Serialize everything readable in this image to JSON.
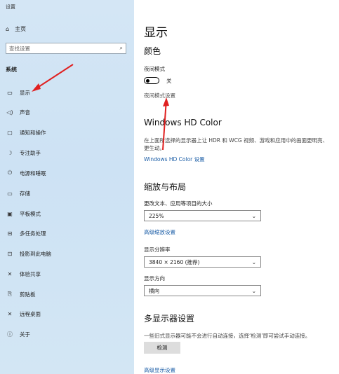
{
  "window": {
    "title": "设置"
  },
  "sidebar": {
    "home": "主页",
    "search_placeholder": "查找设置",
    "section": "系统",
    "items": [
      {
        "label": "显示",
        "icon": "monitor-icon"
      },
      {
        "label": "声音",
        "icon": "speaker-icon"
      },
      {
        "label": "通知和操作",
        "icon": "notification-icon"
      },
      {
        "label": "专注助手",
        "icon": "moon-icon"
      },
      {
        "label": "电源和睡眠",
        "icon": "power-icon"
      },
      {
        "label": "存储",
        "icon": "storage-icon"
      },
      {
        "label": "平板模式",
        "icon": "tablet-icon"
      },
      {
        "label": "多任务处理",
        "icon": "multitask-icon"
      },
      {
        "label": "投影到此电脑",
        "icon": "project-icon"
      },
      {
        "label": "体验共享",
        "icon": "share-icon"
      },
      {
        "label": "剪贴板",
        "icon": "clipboard-icon"
      },
      {
        "label": "远程桌面",
        "icon": "remote-desktop-icon"
      },
      {
        "label": "关于",
        "icon": "info-icon"
      }
    ]
  },
  "main": {
    "title": "显示",
    "color_heading": "颜色",
    "night_mode_label": "夜间模式",
    "night_mode_state": "关",
    "night_mode_settings_link": "夜间模式设置",
    "hdr_heading": "Windows HD Color",
    "hdr_desc": "在上面所选择的显示器上让 HDR 和 WCG 视频、游戏和应用中的画面更明亮、更生动。",
    "hdr_link": "Windows HD Color 设置",
    "scale_heading": "缩放与布局",
    "scale_label": "更改文本、应用等项目的大小",
    "scale_value": "225%",
    "advanced_scale_link": "高级缩放设置",
    "resolution_label": "显示分辨率",
    "resolution_value": "3840 × 2160 (推荐)",
    "orientation_label": "显示方向",
    "orientation_value": "横向",
    "multi_heading": "多显示器设置",
    "multi_desc": "一些旧式显示器可能不会进行自动连接，选择‘检测’即可尝试手动连接。",
    "detect_button": "检测",
    "advanced_display_link": "高级显示设置"
  },
  "colors": {
    "annotation_arrow": "#e02020",
    "link": "#1c5ea7",
    "sidebar_bg": "#d0e4f5"
  }
}
